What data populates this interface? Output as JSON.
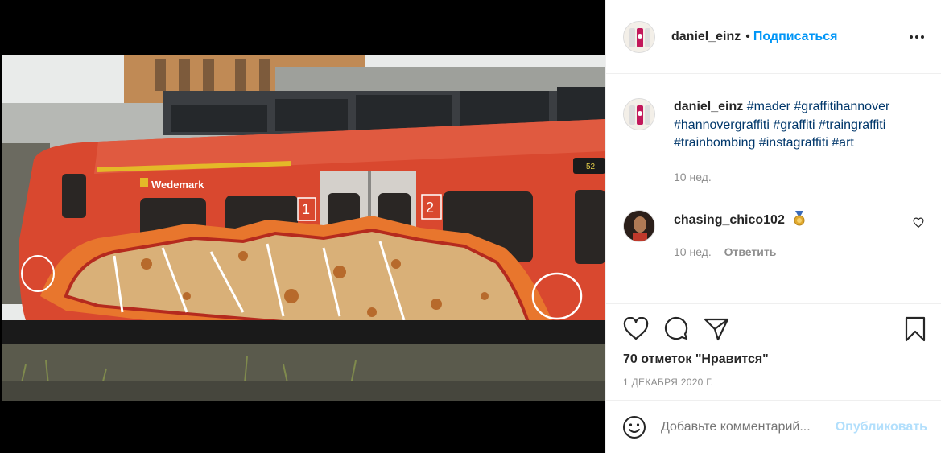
{
  "post": {
    "author": "daniel_einz",
    "follow_label": "Подписаться",
    "separator": "•",
    "caption_tags": "#mader #graffitihannover #hannovergraffiti #graffiti #traingraffiti #trainbombing #instagraffiti #art",
    "caption_age": "10 нед.",
    "photo_text": {
      "train_label": "Wedemark",
      "door_number_1": "1",
      "door_number_2": "2",
      "window_marker": "52"
    }
  },
  "comments": [
    {
      "author": "chasing_chico102",
      "age": "10 нед.",
      "reply_label": "Ответить"
    }
  ],
  "actions": {
    "likes": "70 отметок \"Нравится\"",
    "date": "1 ДЕКАБРЯ 2020 Г."
  },
  "add_comment": {
    "placeholder": "Добавьте комментарий...",
    "post_label": "Опубликовать"
  },
  "icons": {
    "more": "more-options-icon",
    "like": "heart-icon",
    "comment": "comment-bubble-icon",
    "share": "paper-plane-icon",
    "save": "bookmark-icon",
    "emoji": "smiley-icon",
    "badge": "medal-icon"
  },
  "colors": {
    "link_blue": "#0095f6",
    "tag_blue": "#00376b",
    "muted": "#8e8e8e",
    "post_disabled": "#b2dffc",
    "train_red": "#d9482f"
  }
}
